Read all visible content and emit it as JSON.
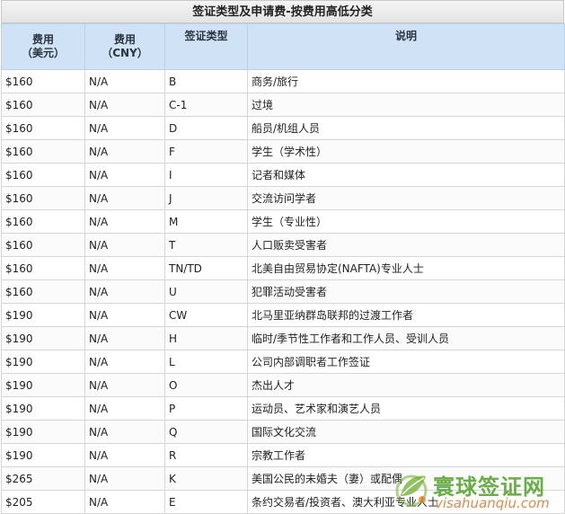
{
  "title": "签证类型及申请费-按费用高低分类",
  "headers": {
    "fee_usd_1": "费用",
    "fee_usd_2": "（美元）",
    "fee_cny_1": "费用",
    "fee_cny_2": "（CNY）",
    "visa_type": "签证类型",
    "description": "说明"
  },
  "rows": [
    {
      "usd": "$160",
      "cny": "N/A",
      "type": "B",
      "desc": "商务/旅行"
    },
    {
      "usd": "$160",
      "cny": "N/A",
      "type": "C-1",
      "desc": "过境"
    },
    {
      "usd": "$160",
      "cny": "N/A",
      "type": "D",
      "desc": "船员/机组人员"
    },
    {
      "usd": "$160",
      "cny": "N/A",
      "type": "F",
      "desc": "学生（学术性）"
    },
    {
      "usd": "$160",
      "cny": "N/A",
      "type": "I",
      "desc": "记者和媒体"
    },
    {
      "usd": "$160",
      "cny": "N/A",
      "type": "J",
      "desc": "交流访问学者"
    },
    {
      "usd": "$160",
      "cny": "N/A",
      "type": "M",
      "desc": "学生（专业性）"
    },
    {
      "usd": "$160",
      "cny": "N/A",
      "type": "T",
      "desc": "人口贩卖受害者"
    },
    {
      "usd": "$160",
      "cny": "N/A",
      "type": "TN/TD",
      "desc": "北美自由贸易协定(NAFTA)专业人士"
    },
    {
      "usd": "$160",
      "cny": "N/A",
      "type": "U",
      "desc": "犯罪活动受害者"
    },
    {
      "usd": "$190",
      "cny": "N/A",
      "type": "CW",
      "desc": "北马里亚纳群岛联邦的过渡工作者"
    },
    {
      "usd": "$190",
      "cny": "N/A",
      "type": "H",
      "desc": "临时/季节性工作者和工作人员、受训人员"
    },
    {
      "usd": "$190",
      "cny": "N/A",
      "type": "L",
      "desc": "公司内部调职者工作签证"
    },
    {
      "usd": "$190",
      "cny": "N/A",
      "type": "O",
      "desc": "杰出人才"
    },
    {
      "usd": "$190",
      "cny": "N/A",
      "type": "P",
      "desc": "运动员、艺术家和演艺人员"
    },
    {
      "usd": "$190",
      "cny": "N/A",
      "type": "Q",
      "desc": "国际文化交流"
    },
    {
      "usd": "$190",
      "cny": "N/A",
      "type": "R",
      "desc": "宗教工作者"
    },
    {
      "usd": "$265",
      "cny": "N/A",
      "type": "K",
      "desc": "美国公民的未婚夫（妻）或配偶"
    },
    {
      "usd": "$205",
      "cny": "N/A",
      "type": "E",
      "desc": "条约交易者/投资者、澳大利亚专业人士"
    }
  ],
  "watermark": {
    "name": "寰球签证网",
    "url": "visahuanqiu.com",
    "icon": "leaf-logo-icon"
  }
}
